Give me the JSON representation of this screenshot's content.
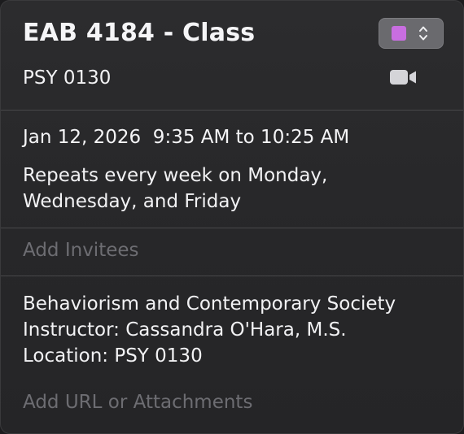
{
  "event": {
    "title": "EAB 4184 - Class",
    "location": "PSY 0130",
    "calendar_color": "#c86ee0"
  },
  "datetime": {
    "date_line": "Jan 12, 2026  9:35 AM to 10:25 AM",
    "repeat": "Repeats every week on Monday, Wednesday, and Friday"
  },
  "invitees": {
    "placeholder": "Add Invitees"
  },
  "notes": {
    "lines": [
      "Behaviorism and Contemporary Society",
      "Instructor: Cassandra O'Hara, M.S.",
      "Location: PSY 0130"
    ]
  },
  "attachments": {
    "placeholder": "Add URL or Attachments"
  },
  "icons": {
    "calendar_picker": "up-down-chevron-icon",
    "video": "video-camera-icon"
  }
}
